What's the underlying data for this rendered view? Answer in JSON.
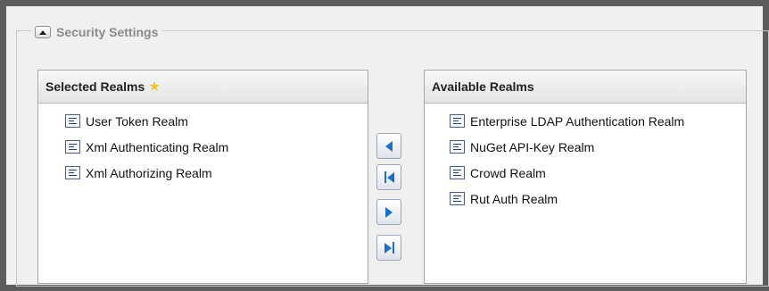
{
  "section": {
    "title": "Security Settings",
    "collapse_icon": "triangle-up-icon"
  },
  "selected_realms": {
    "title": "Selected Realms",
    "star_icon": "star-icon",
    "items": [
      {
        "label": "User Token Realm",
        "icon": "realm-icon"
      },
      {
        "label": "Xml Authenticating Realm",
        "icon": "realm-icon"
      },
      {
        "label": "Xml Authorizing Realm",
        "icon": "realm-icon"
      }
    ]
  },
  "available_realms": {
    "title": "Available Realms",
    "items": [
      {
        "label": "Enterprise LDAP Authentication Realm",
        "icon": "realm-icon"
      },
      {
        "label": "NuGet API-Key Realm",
        "icon": "realm-icon"
      },
      {
        "label": "Crowd Realm",
        "icon": "realm-icon"
      },
      {
        "label": "Rut Auth Realm",
        "icon": "realm-icon"
      }
    ]
  },
  "move_buttons": [
    {
      "icon": "arrow-left-icon"
    },
    {
      "icon": "arrow-left-all-icon"
    },
    {
      "icon": "arrow-right-icon"
    },
    {
      "icon": "arrow-right-all-icon"
    }
  ],
  "colors": {
    "accent": "#1c70c9",
    "star": "#f2c12e",
    "legend_text": "#8a8a8a",
    "window_border": "#5c5c5c",
    "background": "#f0f0f0"
  }
}
